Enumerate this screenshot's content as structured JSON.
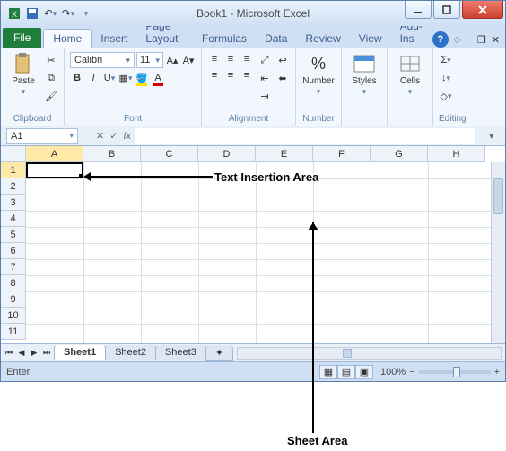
{
  "title": "Book1 - Microsoft Excel",
  "qat": {
    "undo_tip": "Undo",
    "redo_tip": "Redo"
  },
  "tabs": {
    "file": "File",
    "items": [
      "Home",
      "Insert",
      "Page Layout",
      "Formulas",
      "Data",
      "Review",
      "View",
      "Add-Ins"
    ],
    "active": "Home"
  },
  "ribbon": {
    "clipboard": {
      "label": "Clipboard",
      "paste": "Paste"
    },
    "font": {
      "label": "Font",
      "name": "Calibri",
      "size": "11"
    },
    "alignment": {
      "label": "Alignment"
    },
    "number": {
      "label": "Number",
      "btn": "Number",
      "pct": "%"
    },
    "styles": {
      "label": "Styles",
      "btn": "Styles"
    },
    "cells": {
      "label": "Cells",
      "btn": "Cells"
    },
    "editing": {
      "label": "Editing"
    }
  },
  "namebox": "A1",
  "fx_label": "fx",
  "columns": [
    "A",
    "B",
    "C",
    "D",
    "E",
    "F",
    "G",
    "H"
  ],
  "rows": [
    "1",
    "2",
    "3",
    "4",
    "5",
    "6",
    "7",
    "8",
    "9",
    "10",
    "11"
  ],
  "selected_col": "A",
  "selected_row": "1",
  "sheets": {
    "nav": [
      "⏮",
      "◀",
      "▶",
      "⏭"
    ],
    "items": [
      "Sheet1",
      "Sheet2",
      "Sheet3"
    ],
    "active": "Sheet1",
    "new_tip": "+"
  },
  "status": {
    "mode": "Enter",
    "zoom": "100%"
  },
  "annotations": {
    "text_insertion": "Text Insertion Area",
    "sheet_area": "Sheet Area"
  }
}
